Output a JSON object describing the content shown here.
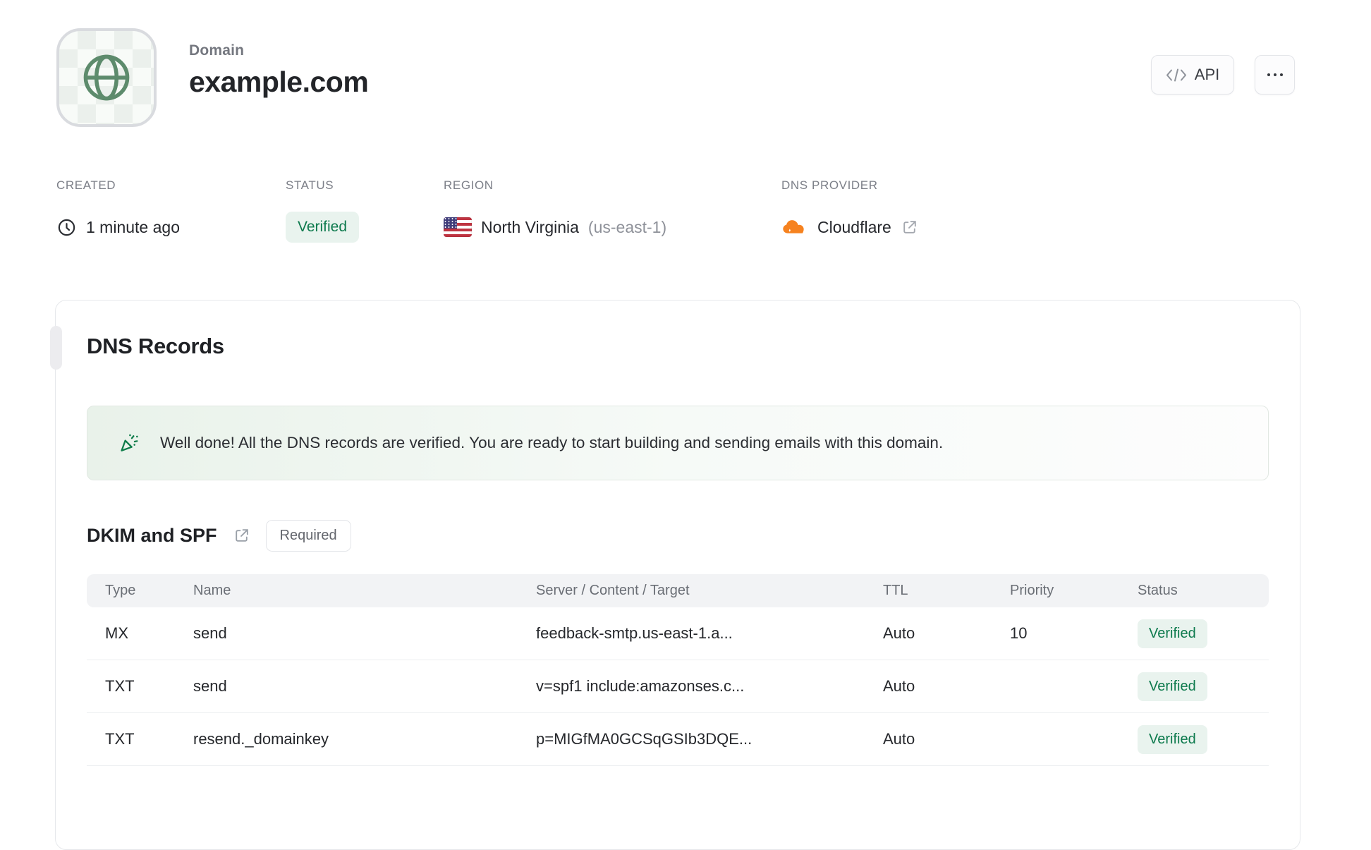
{
  "header": {
    "eyebrow": "Domain",
    "title": "example.com",
    "api_button_label": "API",
    "menu_button_icon": "ellipsis"
  },
  "meta": {
    "created": {
      "label": "CREATED",
      "value": "1 minute ago",
      "icon": "clock"
    },
    "status": {
      "label": "STATUS",
      "value": "Verified"
    },
    "region": {
      "label": "REGION",
      "value": "North Virginia",
      "code": "(us-east-1)",
      "icon": "us-flag"
    },
    "dns_provider": {
      "label": "DNS PROVIDER",
      "value": "Cloudflare",
      "icon": "cloudflare"
    }
  },
  "dns_card": {
    "title": "DNS Records",
    "banner_message": "Well done! All the DNS records are verified. You are ready to start building and sending emails with this domain.",
    "section_title": "DKIM and SPF",
    "section_badge": "Required",
    "table": {
      "columns": [
        "Type",
        "Name",
        "Server / Content / Target",
        "TTL",
        "Priority",
        "Status"
      ],
      "rows": [
        {
          "type": "MX",
          "name": "send",
          "content": "feedback-smtp.us-east-1.a...",
          "ttl": "Auto",
          "priority": "10",
          "status": "Verified"
        },
        {
          "type": "TXT",
          "name": "send",
          "content": "v=spf1 include:amazonses.c...",
          "ttl": "Auto",
          "priority": "",
          "status": "Verified"
        },
        {
          "type": "TXT",
          "name": "resend._domainkey",
          "content": "p=MIGfMA0GCSqGSIb3DQE...",
          "ttl": "Auto",
          "priority": "",
          "status": "Verified"
        }
      ]
    }
  },
  "colors": {
    "success_text": "#0d7a4d",
    "success_bg": "#e9f3ee",
    "banner_green": "#e9f2ea",
    "cloudflare_orange": "#f6821f",
    "globe_green": "#5d8b6c"
  }
}
